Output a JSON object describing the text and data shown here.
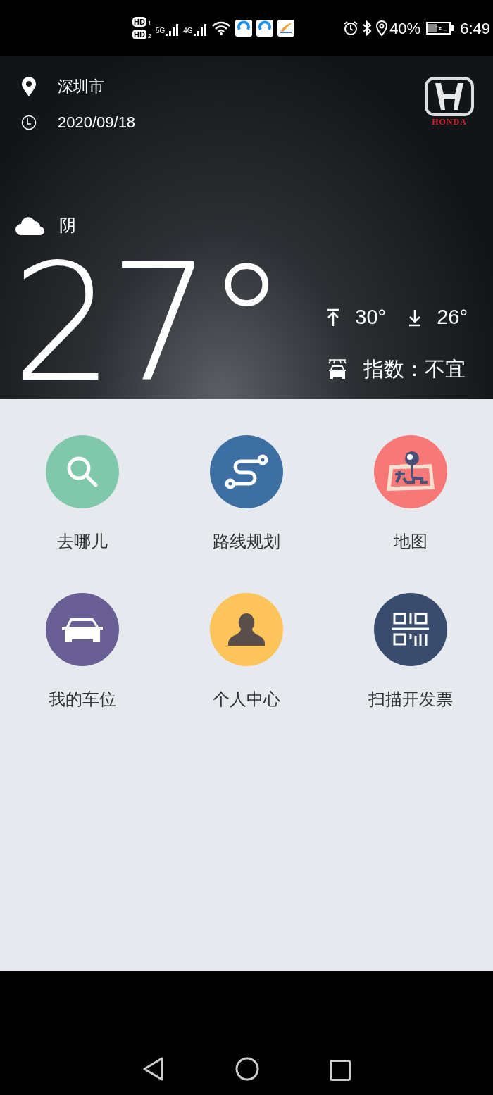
{
  "status_bar": {
    "sim_labels": [
      {
        "label": "HD",
        "slot": "1"
      },
      {
        "label": "HD",
        "slot": "2"
      }
    ],
    "networks": [
      "5G",
      "4G"
    ],
    "battery": "40%",
    "time": "6:49"
  },
  "header": {
    "location": "深圳市",
    "date": "2020/09/18",
    "brand": "HONDA",
    "weather": "阴",
    "temperature": "27°",
    "high": "30°",
    "low": "26°",
    "car_wash_index": "指数：不宜"
  },
  "features": [
    {
      "label": "去哪儿",
      "kind": "search",
      "color": "#7fc8ab"
    },
    {
      "label": "路线规划",
      "kind": "route",
      "color": "#3d6fa3"
    },
    {
      "label": "地图",
      "kind": "map",
      "color": "#f77876"
    },
    {
      "label": "我的车位",
      "kind": "car",
      "color": "#6a5f94"
    },
    {
      "label": "个人中心",
      "kind": "person",
      "color": "#fcc45a"
    },
    {
      "label": "扫描开发票",
      "kind": "qr",
      "color": "#3a4c6d"
    }
  ]
}
